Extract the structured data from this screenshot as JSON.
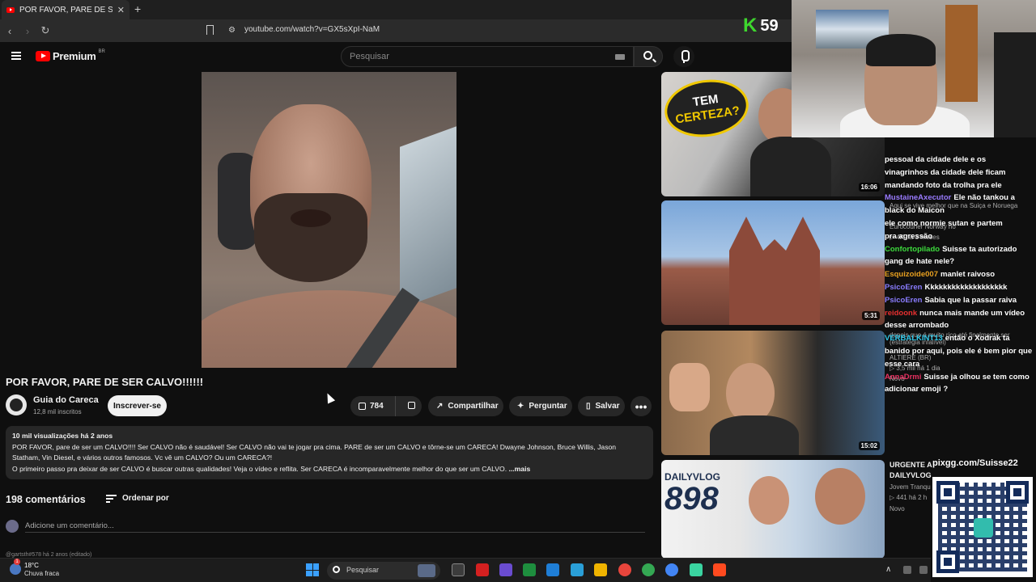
{
  "browser": {
    "tab_title": "POR FAVOR, PARE DE SER CALVO",
    "tab_close": "✕",
    "new_tab": "+",
    "back": "‹",
    "forward": "›",
    "reload": "↻",
    "url": "youtube.com/watch?v=GX5sXpI-NaM"
  },
  "youtube": {
    "logo_text": "Premium",
    "country": "BR",
    "search_placeholder": "Pesquisar"
  },
  "video": {
    "title": "POR FAVOR, PARE DE SER CALVO!!!!!!",
    "channel": "Guia do Careca",
    "subscribers": "12,8 mil inscritos",
    "subscribe_label": "Inscrever-se",
    "likes": "784",
    "share_label": "Compartilhar",
    "ask_label": "Perguntar",
    "save_label": "Salvar",
    "more_label": "•••"
  },
  "description": {
    "meta": "10 mil visualizações  há 2 anos",
    "line1": "POR FAVOR, pare de ser um CALVO!!!! Ser CALVO não é saudável! Ser CALVO não vai te jogar pra cima.  PARE de ser um CALVO e tôrne-se um CARECA! Dwayne Johnson, Bruce Willis, Jason",
    "line2": "Statham, Vin Diesel, e vários outros famosos. Vc vê um CALVO? Ou um CARECA?!",
    "line3": "O primeiro passo pra deixar de ser CALVO é buscar outras qualidades! Veja o vídeo e reflita. Ser CARECA é incomparavelmente melhor do que ser um CALVO.",
    "more": "...mais"
  },
  "comments": {
    "count": "198 comentários",
    "sort_label": "Ordenar por",
    "add_placeholder": "Adicione um comentário...",
    "next_author": "@gartsth#578 há 2 anos (editado)"
  },
  "recommendations": [
    {
      "badge_line1": "TEM",
      "badge_line2": "CERTEZA?",
      "duration": "16:06"
    },
    {
      "duration": "5:31"
    },
    {
      "duration": "15:02"
    },
    {
      "badge_line1": "DAILYVLOG",
      "badge_line2": "898"
    }
  ],
  "side_meta": {
    "r2_title": "Aqui se vive melhor que na Suiça e Noruega",
    "r2_channel": "Eurocouner Norway no",
    "r2_views": "▷ 4K  há 3 meses",
    "r3_title": "depois que é muito rico até finalmente ser (estratégia infalível)",
    "r3_channel": "ALTIERE (BR)",
    "r3_views": "▷ 3,5 mil  há 1 dia",
    "r3_badge": "Novo",
    "r4_title_1": "URGENTE A",
    "r4_title_2": "DAILYVLOG",
    "r4_channel": "Jovem Tranqu",
    "r4_views": "▷ 441  há 2 h",
    "r4_badge": "Novo"
  },
  "stream": {
    "k_letter": "K",
    "k_count": "59",
    "pix_title": "pixgg.com/Suisse22"
  },
  "chat": [
    {
      "user": "",
      "msg": "pessoal da cidade dele e os",
      "color": "#ffffff"
    },
    {
      "user": "",
      "msg": "vinagrinhos da cidade dele ficam",
      "color": "#ffffff"
    },
    {
      "user": "",
      "msg": "mandando foto da trolha pra ele",
      "color": "#ffffff"
    },
    {
      "user": "MustaineAxecutor",
      "msg": "Ele não tankou a black do Maicon",
      "color": "#9a7bff"
    },
    {
      "user": "",
      "msg": "ele como normie sutan e partem",
      "color": "#ffffff"
    },
    {
      "user": "",
      "msg": "pra agressão",
      "color": "#ffffff"
    },
    {
      "user": "Confortopilado",
      "msg": "Suisse ta autorizado gang de hate nele?",
      "color": "#3ddc3d"
    },
    {
      "user": "Esquizoide007",
      "msg": "manlet raivoso",
      "color": "#e8a020"
    },
    {
      "user": "PsicoEren",
      "msg": "Kkkkkkkkkkkkkkkkkkk",
      "color": "#8a7cff"
    },
    {
      "user": "PsicoEren",
      "msg": "Sabia que la passar raiva",
      "color": "#8a7cff"
    },
    {
      "user": "reidoonk",
      "msg": "nunca mais mande um vídeo desse arrombado",
      "color": "#e83030"
    },
    {
      "user": "VERBALKINT13",
      "msg": "então o Xodrak ta banido por aqui, pois ele é bem pior que esse cara",
      "color": "#30c8e8"
    },
    {
      "user": "AnnaDrmi",
      "msg": "Suisse ja olhou se tem como adicionar emoji ?",
      "color": "#e83060"
    }
  ],
  "taskbar": {
    "temp": "18°C",
    "weather": "Chuva fraca",
    "badge": "1",
    "search": "Pesquisar",
    "tray_up": "∧"
  },
  "colors": {
    "yt_red": "#ff0000",
    "k_green": "#3ed62e",
    "pix_teal": "#32bcad"
  }
}
